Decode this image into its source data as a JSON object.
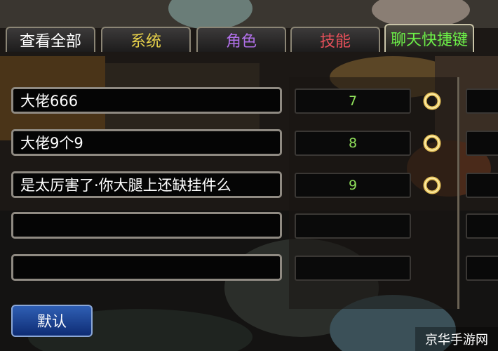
{
  "tabs": [
    {
      "label": "查看全部",
      "color": "#ffffff",
      "active": false
    },
    {
      "label": "系统",
      "color": "#e8d24a",
      "active": false
    },
    {
      "label": "角色",
      "color": "#b070e8",
      "active": false
    },
    {
      "label": "技能",
      "color": "#e8505a",
      "active": false
    },
    {
      "label": "聊天快捷键",
      "color": "#6cf048",
      "active": true
    }
  ],
  "shortcuts": [
    {
      "message": "大佬666",
      "key": "7"
    },
    {
      "message": "大佬9个9",
      "key": "8"
    },
    {
      "message": "是太厉害了·你大腿上还缺挂件么",
      "key": "9"
    },
    {
      "message": "",
      "key": ""
    },
    {
      "message": "",
      "key": ""
    }
  ],
  "default_button": {
    "label": "默认"
  },
  "watermark": {
    "text": "京华手游网"
  },
  "colors": {
    "key_text": "#8fe05a",
    "field_border": "#8f8a82",
    "button_blue": "#1d46a0"
  }
}
